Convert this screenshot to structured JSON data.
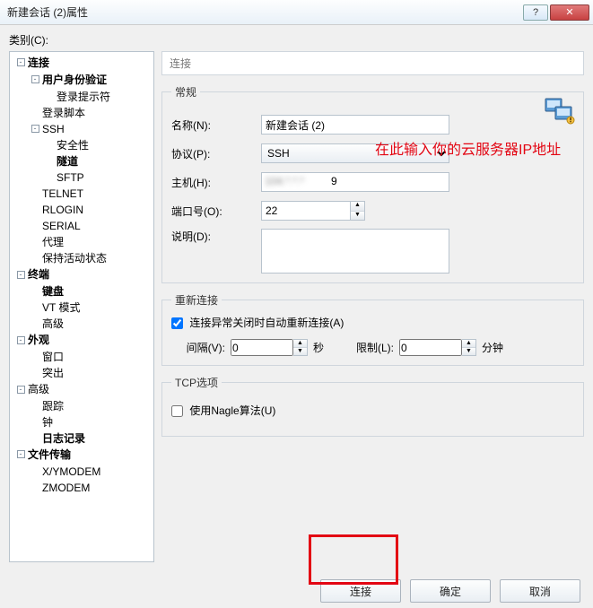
{
  "titlebar": {
    "title": "新建会话 (2)属性"
  },
  "category_label": "类别(C):",
  "tree": {
    "n_connection": "连接",
    "n_userauth": "用户身份验证",
    "n_loginprompt": "登录提示符",
    "n_loginscript": "登录脚本",
    "n_ssh": "SSH",
    "n_security": "安全性",
    "n_tunnel": "隧道",
    "n_sftp": "SFTP",
    "n_telnet": "TELNET",
    "n_rlogin": "RLOGIN",
    "n_serial": "SERIAL",
    "n_proxy": "代理",
    "n_keepalive": "保持活动状态",
    "n_terminal": "终端",
    "n_keyboard": "键盘",
    "n_vt": "VT 模式",
    "n_adv": "高级",
    "n_appearance": "外观",
    "n_window": "窗口",
    "n_highlight": "突出",
    "n_advanced": "高级",
    "n_trace": "跟踪",
    "n_bell": "钟",
    "n_logging": "日志记录",
    "n_filetx": "文件传输",
    "n_xymodem": "X/YMODEM",
    "n_zmodem": "ZMODEM"
  },
  "path": "连接",
  "group_general": "常规",
  "fields": {
    "name_label": "名称(N):",
    "name_value": "新建会话 (2)",
    "protocol_label": "协议(P):",
    "protocol_value": "SSH",
    "host_label": "主机(H):",
    "host_value_suffix": "9",
    "port_label": "端口号(O):",
    "port_value": "22",
    "desc_label": "说明(D):",
    "desc_value": ""
  },
  "group_reconnect": "重新连接",
  "reconnect": {
    "checkbox_label": "连接异常关闭时自动重新连接(A)",
    "checked": true,
    "interval_label": "间隔(V):",
    "interval_value": "0",
    "interval_unit": "秒",
    "limit_label": "限制(L):",
    "limit_value": "0",
    "limit_unit": "分钟"
  },
  "group_tcp": "TCP选项",
  "tcp": {
    "nagle_label": "使用Nagle算法(U)",
    "nagle_checked": false
  },
  "annotation": "在此输入你的云服务器IP地址",
  "buttons": {
    "connect": "连接",
    "ok": "确定",
    "cancel": "取消"
  }
}
